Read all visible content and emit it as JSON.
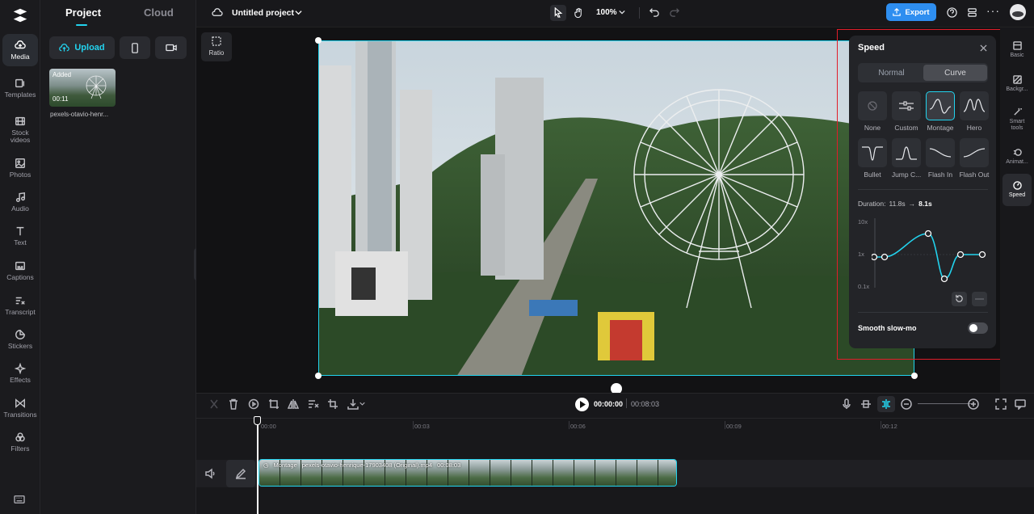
{
  "media_panel": {
    "tabs": [
      "Project",
      "Cloud"
    ],
    "upload_label": "Upload",
    "thumb_badge": "Added",
    "thumb_duration": "00:11",
    "thumb_name": "pexels-otavio-henr..."
  },
  "nav": {
    "items": [
      "Media",
      "Templates",
      "Stock videos",
      "Photos",
      "Audio",
      "Text",
      "Captions",
      "Transcript",
      "Stickers",
      "Effects",
      "Transitions",
      "Filters"
    ]
  },
  "topbar": {
    "project_title": "Untitled project",
    "zoom": "100%",
    "export_label": "Export"
  },
  "canvas": {
    "ratio_label": "Ratio"
  },
  "right_tabs": [
    "Basic",
    "Backgr...",
    "Smart tools",
    "Animat...",
    "Speed"
  ],
  "speed": {
    "title": "Speed",
    "modes": [
      "Normal",
      "Curve"
    ],
    "presets_row1": [
      "None",
      "Custom",
      "Montage",
      "Hero"
    ],
    "presets_row2": [
      "Bullet",
      "Jump C...",
      "Flash In",
      "Flash Out"
    ],
    "duration_label": "Duration:",
    "duration_from": "11.8s",
    "duration_to": "8.1s",
    "y_labels": [
      "10x",
      "1x",
      "0.1x"
    ],
    "smooth_label": "Smooth slow-mo"
  },
  "timeline": {
    "current_time": "00:00:00",
    "total_time": "00:08:03",
    "ruler": [
      "00:00",
      "00:03",
      "00:06",
      "00:09",
      "00:12"
    ],
    "clip_speed": "Montage",
    "clip_name": "pexels-otavio-henrique-17903408 (Original).mp4",
    "clip_duration": "00:08:03"
  },
  "colors": {
    "accent": "#22d3ee",
    "export_bg": "#2e8ef0",
    "highlight_box": "#e11d2a"
  }
}
